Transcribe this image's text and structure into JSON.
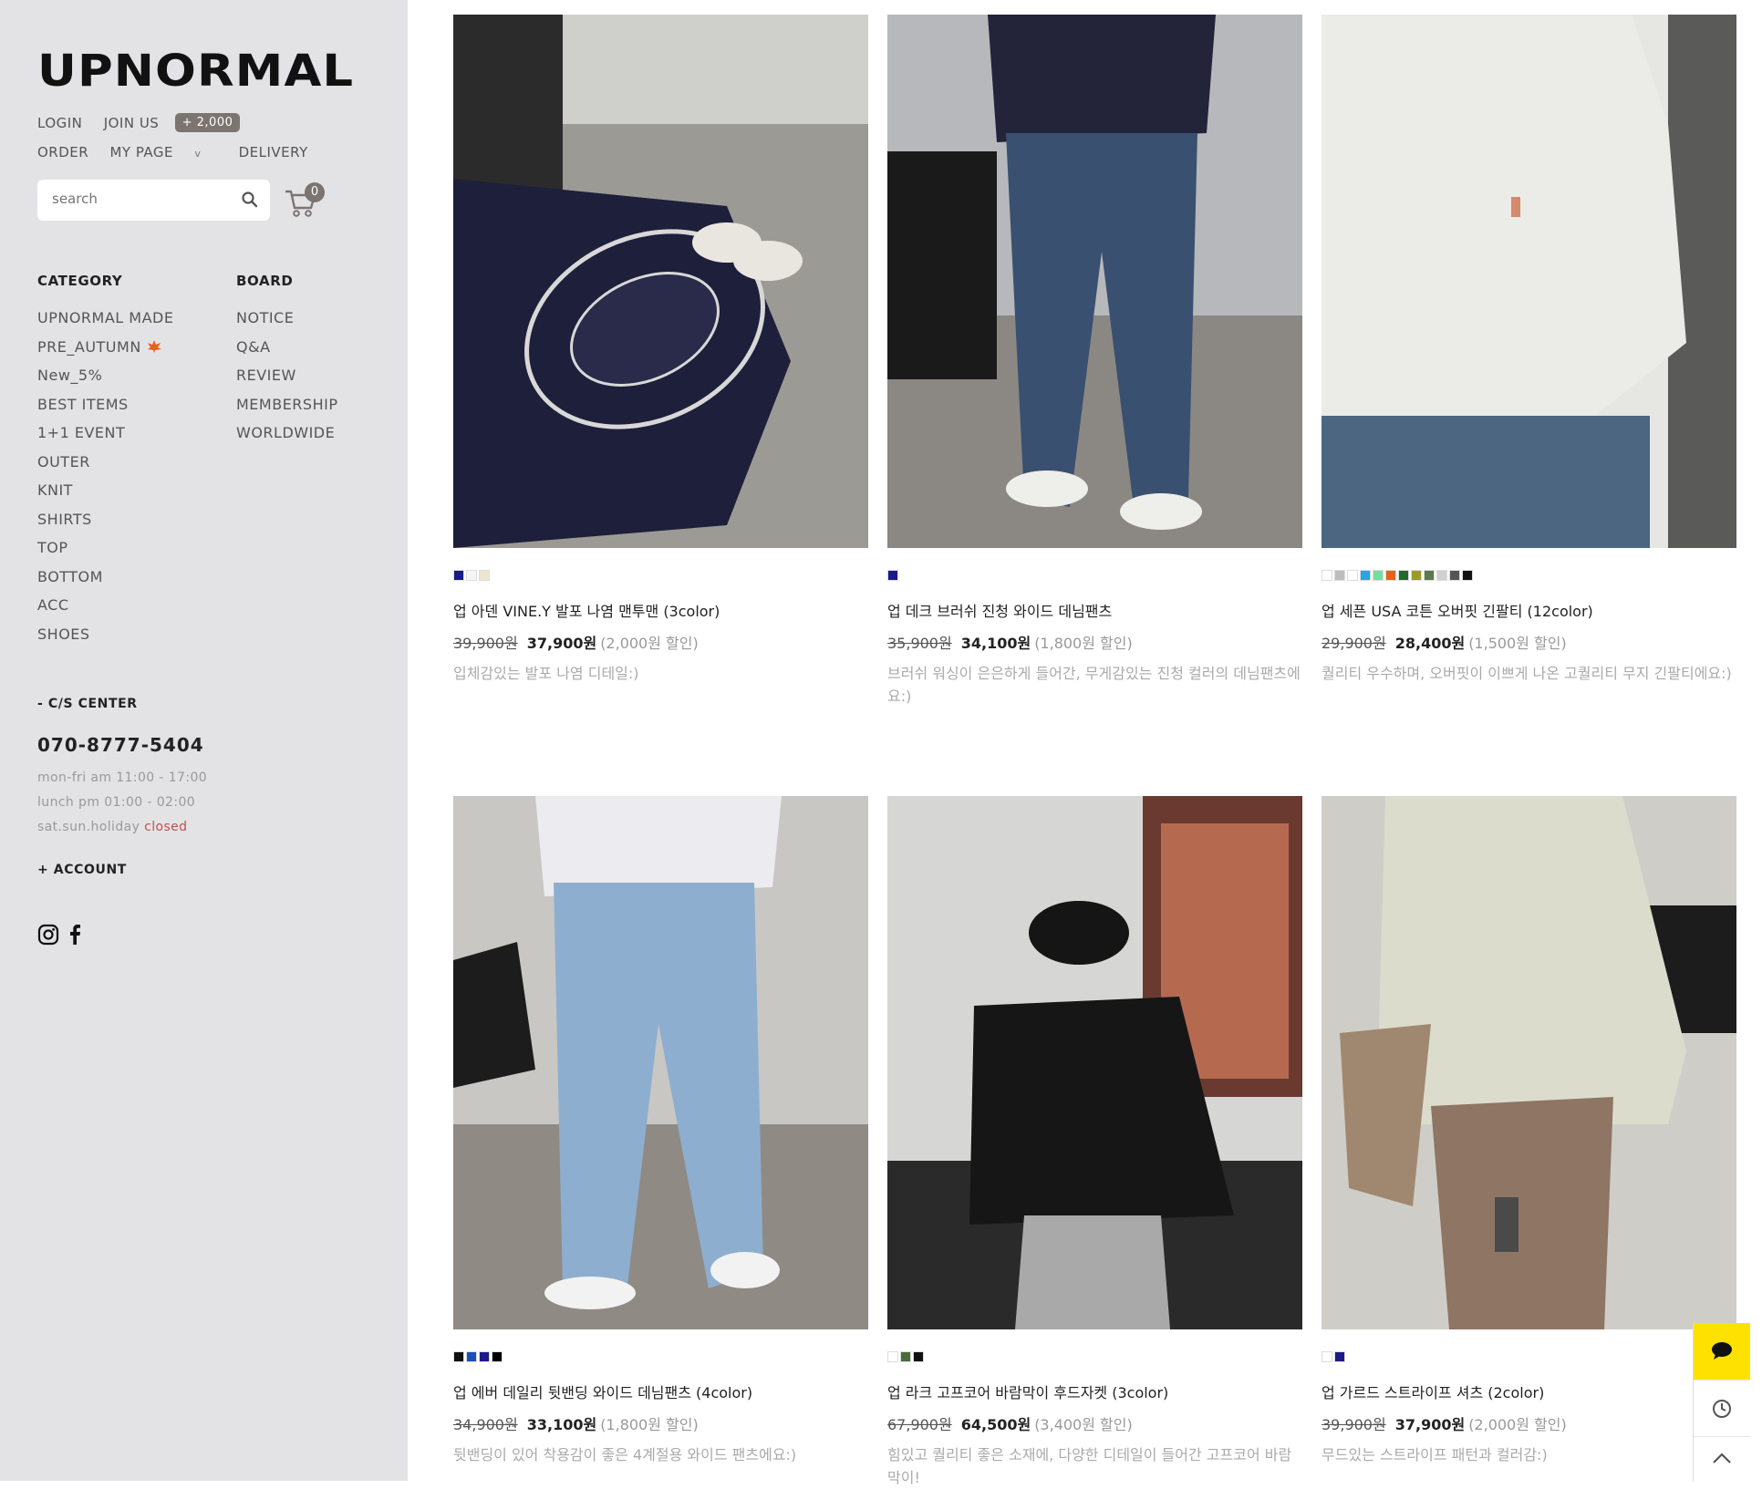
{
  "brand": {
    "logo": "UPNORMAL"
  },
  "header": {
    "login": "LOGIN",
    "join": "JOIN US",
    "join_badge": "+ 2,000",
    "order": "ORDER",
    "mypage": "MY PAGE",
    "mypage_chevron": "v",
    "delivery": "DELIVERY"
  },
  "search": {
    "placeholder": "search",
    "icon": "search-icon"
  },
  "cart": {
    "count": "0",
    "icon": "cart-icon"
  },
  "category": {
    "title": "CATEGORY",
    "items": [
      "UPNORMAL MADE",
      "PRE_AUTUMN",
      "New_5%",
      "BEST ITEMS",
      "1+1 EVENT",
      "OUTER",
      "KNIT",
      "SHIRTS",
      "TOP",
      "BOTTOM",
      "ACC",
      "SHOES"
    ]
  },
  "board": {
    "title": "BOARD",
    "items": [
      "NOTICE",
      "Q&A",
      "REVIEW",
      "MEMBERSHIP",
      "WORLDWIDE"
    ]
  },
  "cs": {
    "title": "- C/S CENTER",
    "phone": "070-8777-5404",
    "hours1": "mon-fri am 11:00 - 17:00",
    "hours2": "lunch pm 01:00 - 02:00",
    "hours3_prefix": "sat.sun.holiday ",
    "hours3_status": "closed"
  },
  "account": {
    "label": "+ ACCOUNT"
  },
  "social": {
    "instagram": "instagram-icon",
    "facebook": "facebook-icon"
  },
  "products": [
    {
      "name": "업 아덴 VINE.Y 발포 나염 맨투맨 (3color)",
      "original": "39,900원",
      "sale": "37,900원",
      "discount": "(2,000원 할인)",
      "desc": "입체감있는 발포 나염 디테일:)",
      "swatches": [
        "#1a1a8a",
        "#f5f5f5",
        "#ece5cf"
      ],
      "image": "navy sweatshirt printed SHENANDOAH VINEYARDS"
    },
    {
      "name": "업 데크 브러쉬 진청 와이드 데님팬츠",
      "original": "35,900원",
      "sale": "34,100원",
      "discount": "(1,800원 할인)",
      "desc": "브러쉬 워싱이 은은하게 들어간, 무게감있는 진청 컬러의 데님팬츠에요:)",
      "swatches": [
        "#1a1a8a"
      ],
      "image": "dark wash wide denim pants"
    },
    {
      "name": "업 세픈 USA 코튼 오버핏 긴팔티 (12color)",
      "original": "29,900원",
      "sale": "28,400원",
      "discount": "(1,500원 할인)",
      "desc": "퀄리티 우수하며, 오버핏이 이쁘게 나온 고퀄리티 무지 긴팔티에요:)",
      "swatches": [
        "#ffffff",
        "#bdbdbd",
        "#ffffff",
        "#22a7e8",
        "#6ee0a0",
        "#e8601c",
        "#1e6b2e",
        "#9c9c24",
        "#5d7a4a",
        "#d0d0d0",
        "#555555",
        "#111111"
      ],
      "image": "white long sleeve tee"
    },
    {
      "name": "업 에버 데일리 뒷밴딩 와이드 데님팬츠 (4color)",
      "original": "34,900원",
      "sale": "33,100원",
      "discount": "(1,800원 할인)",
      "desc": "뒷밴딩이 있어 착용감이 좋은 4계절용 와이드 팬츠에요:)",
      "swatches": [
        "#111111",
        "#1a4fb5",
        "#1a1a8a",
        "#000000"
      ],
      "image": "light blue wide denim pants"
    },
    {
      "name": "업 라크 고프코어 바람막이 후드자켓 (3color)",
      "original": "67,900원",
      "sale": "64,500원",
      "discount": "(3,400원 할인)",
      "desc": "힘있고 퀄리티 좋은 소재에, 다양한 디테일이 들어간 고프코어 바람막이!",
      "swatches": [
        "#ffffff",
        "#4a6b3a",
        "#111111"
      ],
      "image": "black windbreaker hood jacket"
    },
    {
      "name": "업 가르드 스트라이프 셔츠 (2color)",
      "original": "39,900원",
      "sale": "37,900원",
      "discount": "(2,000원 할인)",
      "desc": "무드있는 스트라이프 패턴과 컬러감:)",
      "swatches": [
        "#ffffff",
        "#1a1a8a"
      ],
      "image": "beige striped shirt"
    }
  ],
  "quickmenu": {
    "chat": "chat-icon",
    "recent": "clock-icon",
    "top": "arrow-up-icon"
  }
}
